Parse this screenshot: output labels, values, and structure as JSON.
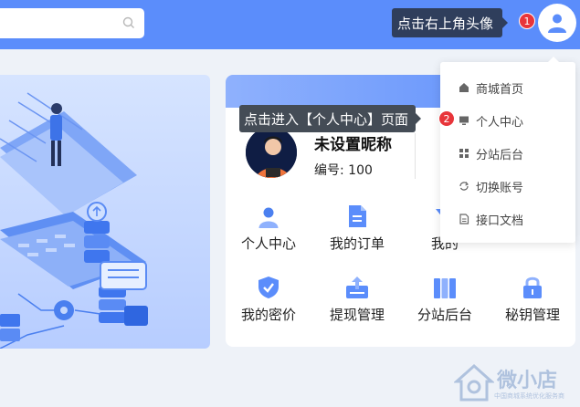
{
  "colors": {
    "brand": "#5b8dfb",
    "tooltip": "#2f3e5c",
    "badge": "#e8353a"
  },
  "search": {
    "placeholder": ""
  },
  "tooltips": {
    "step1": {
      "number": "1",
      "text": "点击右上角头像"
    },
    "step2": {
      "number": "2",
      "text": "点击进入【个人中心】页面"
    }
  },
  "dropdown": {
    "items": [
      {
        "label": "商城首页",
        "icon": "home-icon"
      },
      {
        "label": "个人中心",
        "icon": "monitor-icon"
      },
      {
        "label": "分站后台",
        "icon": "grid-icon"
      },
      {
        "label": "切换账号",
        "icon": "switch-icon"
      },
      {
        "label": "接口文档",
        "icon": "document-icon"
      }
    ]
  },
  "profile": {
    "nickname": "未设置昵称",
    "id_label": "编号: 100"
  },
  "grid": {
    "row1": [
      {
        "label": "个人中心",
        "icon": "user-icon"
      },
      {
        "label": "我的订单",
        "icon": "order-icon"
      },
      {
        "label": "我的",
        "icon": "funnel-icon"
      }
    ],
    "row2": [
      {
        "label": "我的密价",
        "icon": "shield-icon"
      },
      {
        "label": "提现管理",
        "icon": "withdraw-icon"
      },
      {
        "label": "分站后台",
        "icon": "panel-icon"
      },
      {
        "label": "秘钥管理",
        "icon": "lock-icon"
      }
    ]
  },
  "watermark": {
    "title": "微小店",
    "subtitle": "中国商城系统优化服务商"
  }
}
